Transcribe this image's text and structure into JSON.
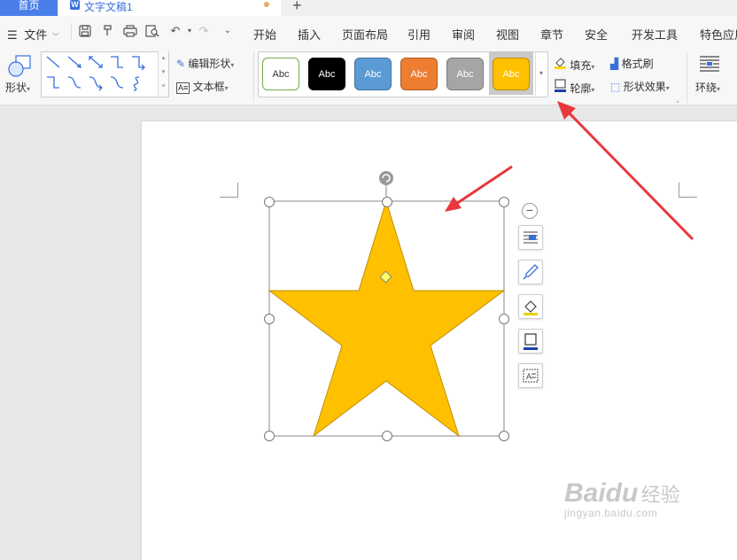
{
  "tabs": {
    "home_label": "首页",
    "doc_title": "文字文稿1",
    "doc_icon": "W",
    "add_label": "+"
  },
  "menu": {
    "file_label": "文件",
    "items": [
      "开始",
      "插入",
      "页面布局",
      "引用",
      "审阅",
      "视图",
      "章节",
      "安全",
      "开发工具",
      "特色应用"
    ]
  },
  "ribbon": {
    "shape_label": "形状",
    "edit_shape_label": "编辑形状",
    "textbox_label": "文本框",
    "fill_label": "填充",
    "format_brush_label": "格式刷",
    "outline_label": "轮廓",
    "shape_effect_label": "形状效果",
    "wrap_label": "环绕",
    "styles": [
      {
        "label": "Abc",
        "bg": "#ffffff",
        "fg": "#333333",
        "border": "#70ad47"
      },
      {
        "label": "Abc",
        "bg": "#000000",
        "fg": "#ffffff",
        "border": "#000000"
      },
      {
        "label": "Abc",
        "bg": "#5b9bd5",
        "fg": "#ffffff",
        "border": "#41719c"
      },
      {
        "label": "Abc",
        "bg": "#ed7d31",
        "fg": "#ffffff",
        "border": "#ae5a21"
      },
      {
        "label": "Abc",
        "bg": "#a5a5a5",
        "fg": "#ffffff",
        "border": "#7b7b7b"
      },
      {
        "label": "Abc",
        "bg": "#ffc000",
        "fg": "#ffffff",
        "border": "#bc8c00"
      }
    ]
  },
  "shape": {
    "type": "star",
    "fill": "#ffc000",
    "stroke": "#c09000"
  },
  "watermark": {
    "brand": "Baidu",
    "brand_cn": "经验",
    "url": "jingyan.baidu.com"
  },
  "colors": {
    "accent": "#4a7ee8",
    "arrow": "#e8383d"
  }
}
